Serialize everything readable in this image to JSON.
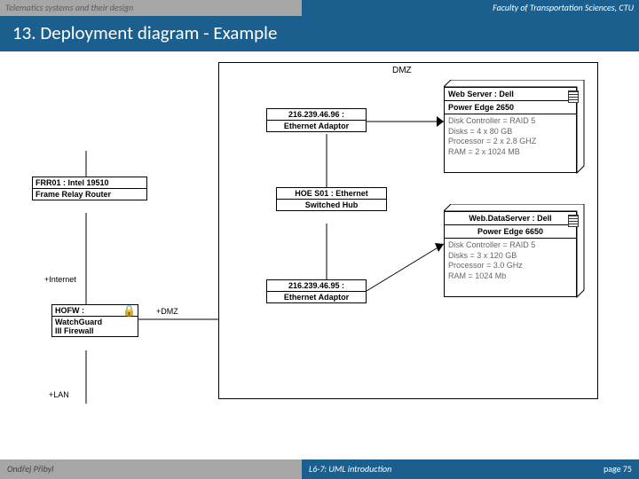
{
  "header": {
    "left": "Telematics systems and their design",
    "right": "Faculty of Transportation Sciences, CTU",
    "title": "13. Deployment diagram - Example"
  },
  "footer": {
    "author": "Ondřej Přibyl",
    "lecture": "L6-7: UML introduction",
    "page": "page 75"
  },
  "diagram": {
    "dmz_label": "DMZ",
    "web_server": {
      "title1": "Web Server : Dell",
      "title2": "Power Edge 2650",
      "attrs": [
        "Disk Controller = RAID 5",
        "Disks = 4 x 80 GB",
        "Processor = 2 x 2.8 GHZ",
        "RAM = 2 x 1024 MB"
      ]
    },
    "eth1": {
      "line1": "216.239.46.96 :",
      "line2": "Ethernet Adaptor"
    },
    "frr": {
      "line1": "FRR01 : Intel 19510",
      "line2": "Frame Relay Router"
    },
    "hub": {
      "line1": "HOE S01 : Ethernet",
      "line2": "Switched Hub"
    },
    "data_server": {
      "title1": "Web.DataServer : Dell",
      "title2": "Power Edge 6650",
      "attrs": [
        "Disk Controller = RAID 5",
        "Disks = 3 x 120 GB",
        "Processor = 3.0 GHz",
        "RAM = 1024 Mb"
      ]
    },
    "eth2": {
      "line1": "216.239.46.95 :",
      "line2": "Ethernet Adaptor"
    },
    "hofw": {
      "line1": "HOFW :",
      "line2": "WatchGuard",
      "line3": "III Firewall"
    },
    "labels": {
      "internet": "+Internet",
      "dmz": "+DMZ",
      "lan": "+LAN"
    }
  }
}
